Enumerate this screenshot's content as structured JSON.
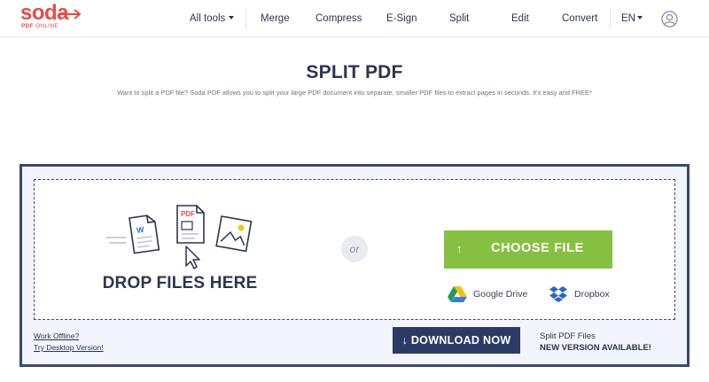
{
  "brand": {
    "logo_text": "soda",
    "logo_sub_bold": "PDF",
    "logo_sub": "ONLINE",
    "color": "#e94a47"
  },
  "nav": {
    "items": [
      {
        "label": "All tools",
        "icon": "chevron-down-icon"
      },
      {
        "label": "Merge"
      },
      {
        "label": "Compress"
      },
      {
        "label": "E-Sign"
      },
      {
        "label": "Split"
      },
      {
        "label": "Edit"
      },
      {
        "label": "Convert"
      }
    ],
    "language": "EN",
    "account_icon": "user-icon"
  },
  "hero": {
    "title": "SPLIT PDF",
    "subtitle": "Want to split a PDF file? Soda PDF allows you to split your large PDF document into separate, smaller PDF files to extract pages in seconds. It's easy and FREE*"
  },
  "upload": {
    "drop_label": "DROP FILES HERE",
    "or_label": "or",
    "choose_button": "CHOOSE FILE",
    "choose_icon": "arrow-up-icon",
    "illustration_pdf_label": "PDF",
    "illustration_word_label": "W",
    "sources": [
      {
        "label": "Google Drive",
        "icon": "google-drive-icon"
      },
      {
        "label": "Dropbox",
        "icon": "dropbox-icon"
      }
    ]
  },
  "footer": {
    "offline_line1": "Work Offline?",
    "offline_line2": "Try Desktop Version!",
    "download_button": "↓ DOWNLOAD NOW",
    "version_line1": "Split PDF Files",
    "version_line2": "NEW VERSION AVAILABLE!"
  },
  "colors": {
    "accent_green": "#86c041",
    "navy": "#2c3a66",
    "text": "#2c3550"
  }
}
